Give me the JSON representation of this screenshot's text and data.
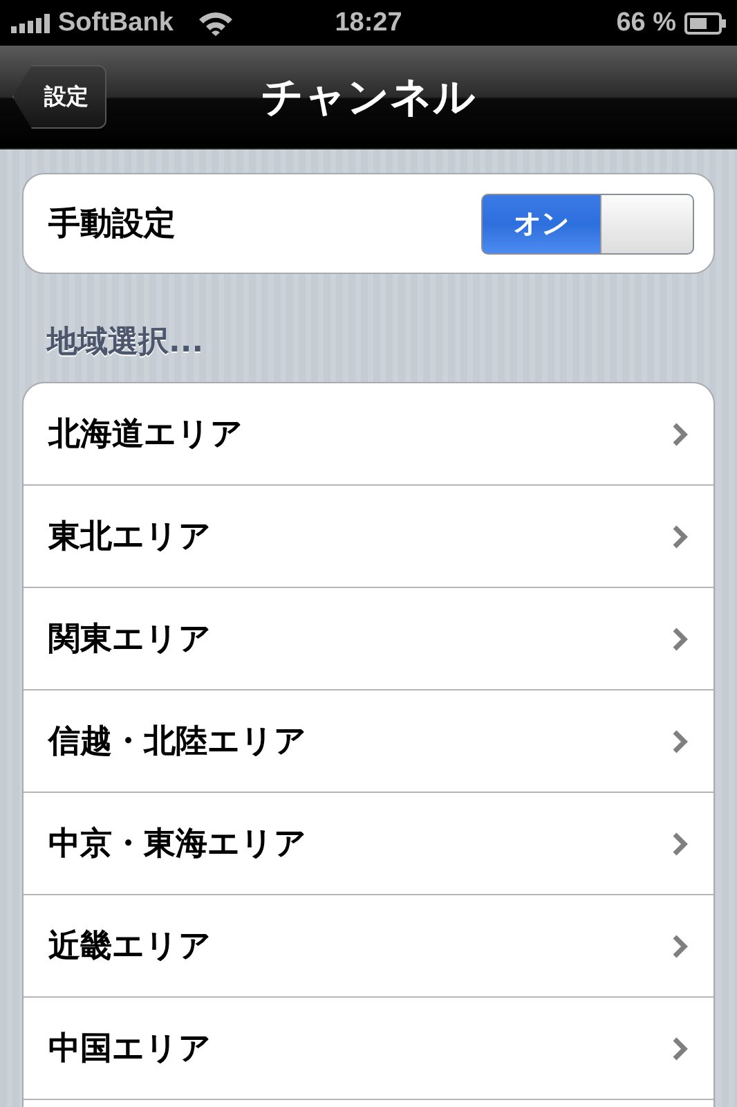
{
  "status_bar": {
    "carrier": "SoftBank",
    "time": "18:27",
    "battery": "66 %"
  },
  "nav_bar": {
    "back": "設定",
    "title": "チャンネル"
  },
  "manual": {
    "label": "手動設定",
    "toggle_text": "オン",
    "on": true
  },
  "section_header": "地域選択...",
  "regions": [
    {
      "label": "北海道エリア"
    },
    {
      "label": "東北エリア"
    },
    {
      "label": "関東エリア"
    },
    {
      "label": "信越・北陸エリア"
    },
    {
      "label": "中京・東海エリア"
    },
    {
      "label": "近畿エリア"
    },
    {
      "label": "中国エリア"
    }
  ]
}
